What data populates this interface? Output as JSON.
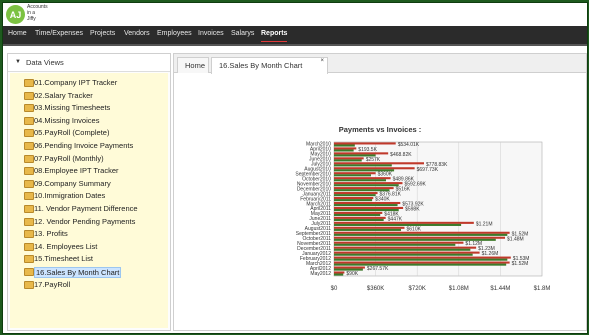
{
  "logo": {
    "initials": "AJ",
    "line1": "Accounts",
    "line2": "in a",
    "line3": "Jiffy"
  },
  "nav": [
    {
      "label": "Home"
    },
    {
      "label": "Time/Expenses"
    },
    {
      "label": "Projects"
    },
    {
      "label": "Vendors"
    },
    {
      "label": "Employees"
    },
    {
      "label": "Invoices"
    },
    {
      "label": "Salarys"
    },
    {
      "label": "Reports",
      "active": true
    }
  ],
  "sidebar": {
    "title": "Data Views",
    "items": [
      "01.Company IPT Tracker",
      "02.Salary Tracker",
      "03.Missing Timesheets",
      "04.Missing Invoices",
      "05.PayRoll (Complete)",
      "06.Pending Invoice Payments",
      "07.PayRoll (Monthly)",
      "08.Employee IPT Tracker",
      "09.Company Summary",
      "10.Immigration Dates",
      "11. Vendor Payment Difference",
      "12. Vendor Pending Payments",
      "13. Profits",
      "14. Employees List",
      "15.Timesheet List",
      "16.Sales By Month Chart",
      "17.PayRoll"
    ],
    "selected_index": 15
  },
  "tabs": {
    "home": "Home",
    "active": "16.Sales By Month Chart",
    "close": "×"
  },
  "colors": {
    "nav_bg": "#2b2b2b",
    "accent": "#e03a3a",
    "sidebar_bg": "#fffbd8",
    "bar_red": "#c0392b",
    "bar_green": "#3c7a2a"
  },
  "chart_data": {
    "type": "bar",
    "orientation": "horizontal",
    "title": "Payments vs Invoices :",
    "categories": [
      "March2010",
      "April2010",
      "May2010",
      "June2010",
      "July2010",
      "August2010",
      "September2010",
      "October2010",
      "November2010",
      "December2010",
      "January2011",
      "February2011",
      "March2011",
      "April2011",
      "May2011",
      "June2011",
      "July2011",
      "August2011",
      "September2011",
      "October2011",
      "November2011",
      "December2011",
      "January2012",
      "February2012",
      "March2012",
      "April2012",
      "May2012"
    ],
    "series": [
      {
        "color": "#c0392b",
        "values": [
          534010,
          193000,
          468820,
          257000,
          778830,
          697730,
          360000,
          489860,
          592690,
          516000,
          376810,
          340000,
          573920,
          598000,
          418000,
          447000,
          1210000,
          610000,
          1520000,
          1480000,
          1120000,
          1230000,
          1260000,
          1530000,
          1520000,
          267570,
          90000
        ]
      },
      {
        "color": "#3c7a2a",
        "values": [
          180000,
          170000,
          360000,
          240000,
          500000,
          520000,
          320000,
          450000,
          560000,
          480000,
          360000,
          330000,
          550000,
          560000,
          400000,
          430000,
          1100000,
          580000,
          1500000,
          1400000,
          1050000,
          1180000,
          1200000,
          1500000,
          1490000,
          250000,
          80000
        ]
      }
    ],
    "value_labels": [
      "$534.01K",
      "$193.5K",
      "$468.82K",
      "$257K",
      "$778.83K",
      "$697.73K",
      "$360K",
      "$489.86K",
      "$592.69K",
      "$516K",
      "$376.81K",
      "$340K",
      "$573.92K",
      "$598K",
      "$418K",
      "$447K",
      "$1.21M",
      "$610K",
      "$1.52M",
      "$1.48M",
      "$1.12M",
      "$1.23M",
      "$1.26M",
      "$1.53M",
      "$1.52M",
      "$267.57K",
      "$90K"
    ],
    "xticks": [
      "$0",
      "$360K",
      "$720K",
      "$1.08M",
      "$1.44M",
      "$1.8M"
    ],
    "xlim": [
      0,
      1800000
    ]
  }
}
